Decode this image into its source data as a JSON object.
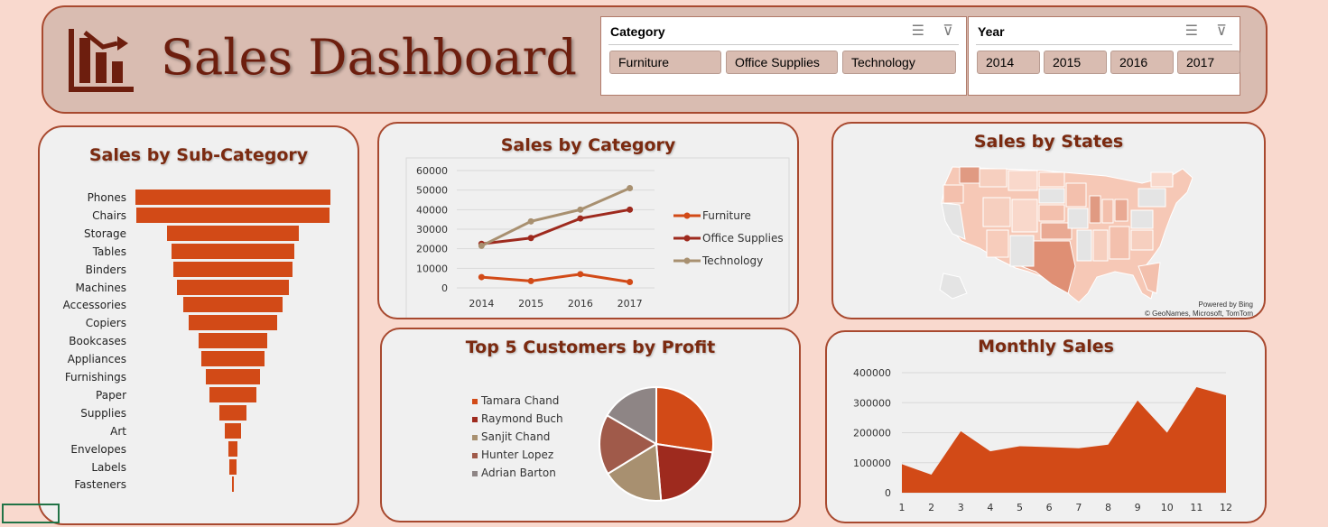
{
  "header": {
    "title": "Sales Dashboard",
    "logo_icon": "bar-chart-logo-icon"
  },
  "slicers": {
    "category": {
      "title": "Category",
      "items": [
        "Furniture",
        "Office Supplies",
        "Technology"
      ],
      "multi_select_icon": "multi-select-icon",
      "clear_filter_icon": "clear-filter-icon"
    },
    "year": {
      "title": "Year",
      "items": [
        "2014",
        "2015",
        "2016",
        "2017"
      ],
      "multi_select_icon": "multi-select-icon",
      "clear_filter_icon": "clear-filter-icon"
    }
  },
  "panels": {
    "subcategory_title": "Sales by Sub-Category",
    "category_title": "Sales by Category",
    "states_title": "Sales by States",
    "customers_title": "Top 5 Customers by Profit",
    "monthly_title": "Monthly Sales"
  },
  "map": {
    "attribution_1": "Powered by Bing",
    "attribution_2": "© GeoNames, Microsoft, TomTom"
  },
  "colors": {
    "accent": "#d24a17",
    "dark_red": "#9e2a1e",
    "tan": "#a89070",
    "border": "#a8492f",
    "title": "#7b2a10"
  },
  "chart_data": [
    {
      "id": "subcategory",
      "type": "bar",
      "orientation": "horizontal-funnel",
      "categories": [
        "Phones",
        "Chairs",
        "Storage",
        "Tables",
        "Binders",
        "Machines",
        "Accessories",
        "Copiers",
        "Bookcases",
        "Appliances",
        "Furnishings",
        "Paper",
        "Supplies",
        "Art",
        "Envelopes",
        "Labels",
        "Fasteners"
      ],
      "values": [
        330000,
        328000,
        224000,
        207000,
        203000,
        189000,
        167000,
        150000,
        115000,
        108000,
        92000,
        78000,
        47000,
        27000,
        16000,
        12000,
        3000
      ],
      "title": "Sales by Sub-Category"
    },
    {
      "id": "category",
      "type": "line",
      "title": "Sales by Category",
      "x": [
        "2014",
        "2015",
        "2016",
        "2017"
      ],
      "series": [
        {
          "name": "Furniture",
          "values": [
            5500,
            3500,
            7000,
            3000
          ],
          "color": "#d24a17"
        },
        {
          "name": "Office Supplies",
          "values": [
            22500,
            25500,
            35500,
            40000
          ],
          "color": "#9e2a1e"
        },
        {
          "name": "Technology",
          "values": [
            21500,
            34000,
            40000,
            51000
          ],
          "color": "#a89070"
        }
      ],
      "yticks": [
        "0",
        "10000",
        "20000",
        "30000",
        "40000",
        "50000",
        "60000"
      ],
      "ylim": [
        0,
        60000
      ],
      "legend": "right"
    },
    {
      "id": "customers",
      "type": "pie",
      "title": "Top 5 Customers by Profit",
      "labels": [
        "Tamara Chand",
        "Raymond Buch",
        "Sanjit Chand",
        "Hunter Lopez",
        "Adrian Barton"
      ],
      "values": [
        8981,
        6976,
        5757,
        5622,
        5444
      ],
      "colors": [
        "#d24a17",
        "#9e2a1e",
        "#a89070",
        "#a05a4a",
        "#8e8585"
      ],
      "legend": "left"
    },
    {
      "id": "monthly",
      "type": "area",
      "title": "Monthly Sales",
      "x": [
        "1",
        "2",
        "3",
        "4",
        "5",
        "6",
        "7",
        "8",
        "9",
        "10",
        "11",
        "12"
      ],
      "values": [
        95000,
        60000,
        205000,
        138000,
        155000,
        152000,
        148000,
        160000,
        307000,
        200000,
        352000,
        325000
      ],
      "yticks": [
        "0",
        "100000",
        "200000",
        "300000",
        "400000"
      ],
      "ylim": [
        0,
        400000
      ],
      "color": "#d24a17"
    }
  ]
}
